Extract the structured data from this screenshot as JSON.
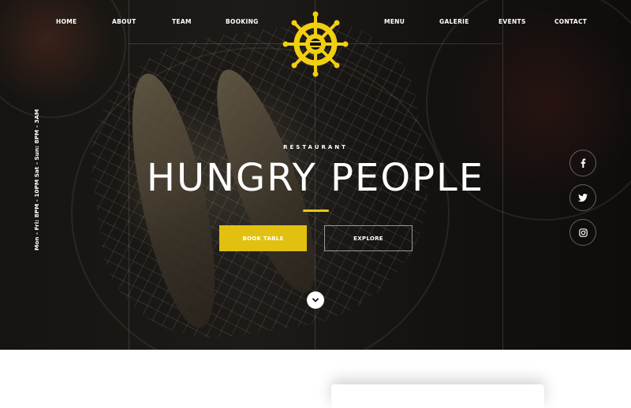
{
  "nav": {
    "left": [
      "HOME",
      "ABOUT",
      "TEAM",
      "BOOKING"
    ],
    "right": [
      "MENU",
      "GALERIE",
      "EVENTS",
      "CONTACT"
    ]
  },
  "logo": {
    "icon": "ship-wheel-icon",
    "color": "#f2cf0f"
  },
  "hours": "Mon - Fri: 8PM - 10PM  Sat - Sun: 8PM - 3AM",
  "hero": {
    "eyebrow": "RESTAURANT",
    "title": "HUNGRY PEOPLE",
    "book_label": "BOOK TABLE",
    "explore_label": "EXPLORE"
  },
  "social": [
    "facebook-icon",
    "twitter-icon",
    "instagram-icon"
  ],
  "colors": {
    "accent": "#e2c00f",
    "dark": "#141210",
    "text": "#ffffff"
  }
}
